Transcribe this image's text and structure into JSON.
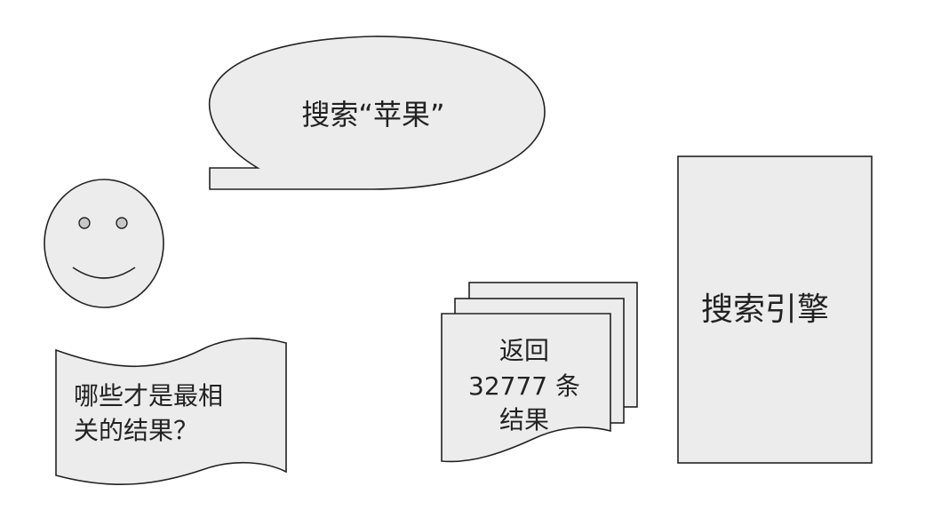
{
  "colors": {
    "shape_fill": "#ececec",
    "stroke": "#222222",
    "text": "#222222",
    "background": "#ffffff"
  },
  "speech_bubble": {
    "text": "搜索“苹果”"
  },
  "user": {
    "icon": "smiley-face-icon"
  },
  "question_doc": {
    "line1": "哪些才是最相",
    "line2": "关的结果？"
  },
  "results_stack": {
    "line1": "返回",
    "line2": "32777 条",
    "line3": "结果"
  },
  "search_engine": {
    "label": "搜索引擎"
  }
}
